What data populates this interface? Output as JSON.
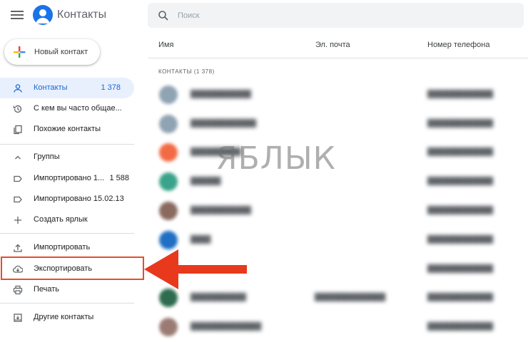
{
  "app": {
    "title": "Контакты"
  },
  "sidebar": {
    "new_contact_label": "Новый контакт",
    "items": [
      {
        "label": "Контакты",
        "count": "1 378",
        "icon": "person-icon",
        "active": true
      },
      {
        "label": "С кем вы часто общае...",
        "icon": "history-icon"
      },
      {
        "label": "Похожие контакты",
        "icon": "copy-icon"
      },
      {
        "label": "Группы",
        "icon": "chevron-up-icon"
      },
      {
        "label": "Импортировано 1...",
        "count": "1 588",
        "icon": "label-icon"
      },
      {
        "label": "Импортировано 15.02.13",
        "icon": "label-icon"
      },
      {
        "label": "Создать ярлык",
        "icon": "plus-icon"
      },
      {
        "label": "Импортировать",
        "icon": "upload-icon"
      },
      {
        "label": "Экспортировать",
        "icon": "cloud-download-icon"
      },
      {
        "label": "Печать",
        "icon": "printer-icon"
      },
      {
        "label": "Другие контакты",
        "icon": "archive-icon"
      }
    ]
  },
  "search": {
    "placeholder": "Поиск"
  },
  "table": {
    "columns": [
      "Имя",
      "Эл. почта",
      "Номер телефона"
    ],
    "section_title": "КОНТАКТЫ (1 378)"
  },
  "watermark": "ЯБЛЫК",
  "colors": {
    "accent": "#1a73e8",
    "active_bg": "#e8f0fe",
    "active_text": "#1967d2",
    "highlight": "#e74c2e"
  }
}
